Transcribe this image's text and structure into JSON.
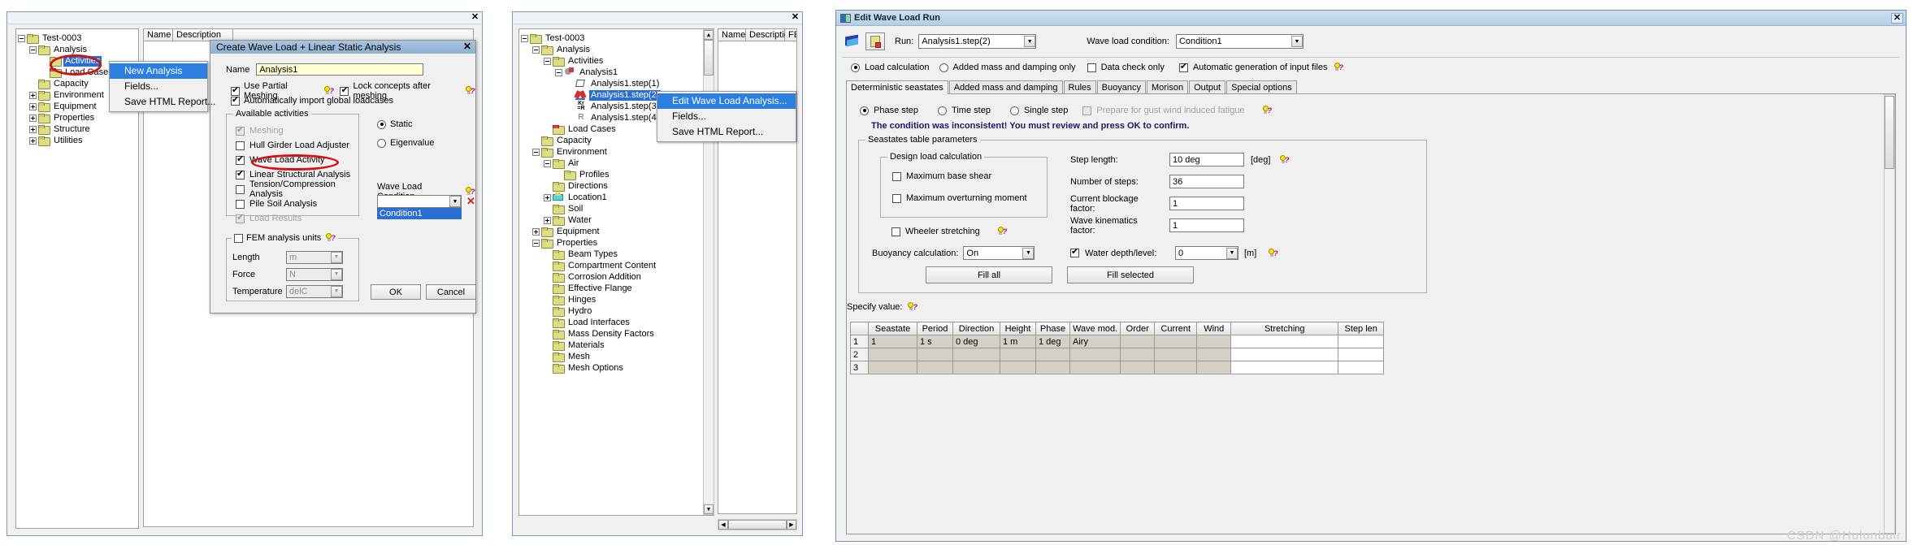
{
  "panel1": {
    "window": {
      "close_label": "✕"
    },
    "tree": {
      "nodes": [
        {
          "label": "Test-0003",
          "depth": 0,
          "toggle": "minus",
          "icon": "folder"
        },
        {
          "label": "Analysis",
          "depth": 1,
          "toggle": "minus",
          "icon": "folder"
        },
        {
          "label": "Activities",
          "depth": 2,
          "toggle": "none",
          "icon": "folder",
          "selected": true
        },
        {
          "label": "Load Cases",
          "depth": 2,
          "toggle": "none",
          "icon": "folder-red"
        },
        {
          "label": "Capacity",
          "depth": 1,
          "toggle": "none",
          "icon": "folder"
        },
        {
          "label": "Environment",
          "depth": 1,
          "toggle": "plus",
          "icon": "folder"
        },
        {
          "label": "Equipment",
          "depth": 1,
          "toggle": "plus",
          "icon": "folder"
        },
        {
          "label": "Properties",
          "depth": 1,
          "toggle": "plus",
          "icon": "folder"
        },
        {
          "label": "Structure",
          "depth": 1,
          "toggle": "plus",
          "icon": "folder"
        },
        {
          "label": "Utilities",
          "depth": 1,
          "toggle": "plus",
          "icon": "folder"
        }
      ]
    },
    "grid": {
      "col_name": "Name",
      "col_desc": "Description"
    },
    "contextmenu": {
      "items": [
        {
          "label": "New Analysis",
          "highlighted": true
        },
        {
          "label": "Fields...",
          "highlighted": false
        },
        {
          "label": "Save HTML Report...",
          "highlighted": false
        }
      ]
    },
    "dialog": {
      "title": "Create Wave Load + Linear Static Analysis",
      "close_label": "✕",
      "name_label": "Name",
      "name_value": "Analysis1",
      "use_partial_meshing": "Use Partial Meshing",
      "lock_concepts": "Lock concepts after meshing",
      "auto_import": "Automatically import global loadcases",
      "available_activities_caption": "Available activities",
      "activities": [
        {
          "label": "Meshing",
          "checked": true,
          "disabled": true
        },
        {
          "label": "Hull Girder Load Adjuster",
          "checked": false,
          "disabled": false
        },
        {
          "label": "Wave Load Activity",
          "checked": true,
          "disabled": false
        },
        {
          "label": "Linear Structural Analysis",
          "checked": true,
          "disabled": false
        },
        {
          "label": "Tension/Compression Analysis",
          "checked": false,
          "disabled": false
        },
        {
          "label": "Pile Soil Analysis",
          "checked": false,
          "disabled": false
        },
        {
          "label": "Load Results",
          "checked": true,
          "disabled": true
        }
      ],
      "radio_static": "Static",
      "radio_eigenvalue": "Eigenvalue",
      "wave_load_condition_label": "Wave Load Condition",
      "wave_load_condition_value": "",
      "wave_load_condition_option": "Condition1",
      "fem_units_caption": "FEM analysis units",
      "units": [
        {
          "label": "Length",
          "value": "m"
        },
        {
          "label": "Force",
          "value": "N"
        },
        {
          "label": "Temperature",
          "value": "delC"
        }
      ],
      "ok_label": "OK",
      "cancel_label": "Cancel"
    }
  },
  "panel2": {
    "window": {
      "close_label": "✕"
    },
    "tree": {
      "nodes": [
        {
          "label": "Test-0003",
          "depth": 0,
          "toggle": "minus",
          "icon": "folder"
        },
        {
          "label": "Analysis",
          "depth": 1,
          "toggle": "minus",
          "icon": "folder"
        },
        {
          "label": "Activities",
          "depth": 2,
          "toggle": "minus",
          "icon": "folder"
        },
        {
          "label": "Analysis1",
          "depth": 3,
          "toggle": "minus",
          "icon": "analysis"
        },
        {
          "label": "Analysis1.step(1)",
          "depth": 4,
          "toggle": "none",
          "icon": "step-mesh"
        },
        {
          "label": "Analysis1.step(2)",
          "depth": 4,
          "toggle": "none",
          "icon": "step-wave",
          "selected": true
        },
        {
          "label": "Analysis1.step(3)",
          "depth": 4,
          "toggle": "none",
          "icon": "step-kr"
        },
        {
          "label": "Analysis1.step(4)",
          "depth": 4,
          "toggle": "none",
          "icon": "step-r"
        },
        {
          "label": "Load Cases",
          "depth": 2,
          "toggle": "none",
          "icon": "folder-red"
        },
        {
          "label": "Capacity",
          "depth": 1,
          "toggle": "none",
          "icon": "folder"
        },
        {
          "label": "Environment",
          "depth": 1,
          "toggle": "minus",
          "icon": "folder"
        },
        {
          "label": "Air",
          "depth": 2,
          "toggle": "minus",
          "icon": "folder"
        },
        {
          "label": "Profiles",
          "depth": 3,
          "toggle": "none",
          "icon": "folder"
        },
        {
          "label": "Directions",
          "depth": 2,
          "toggle": "none",
          "icon": "folder"
        },
        {
          "label": "Location1",
          "depth": 2,
          "toggle": "plus",
          "icon": "location"
        },
        {
          "label": "Soil",
          "depth": 2,
          "toggle": "none",
          "icon": "folder"
        },
        {
          "label": "Water",
          "depth": 2,
          "toggle": "plus",
          "icon": "folder"
        },
        {
          "label": "Equipment",
          "depth": 1,
          "toggle": "plus",
          "icon": "folder"
        },
        {
          "label": "Properties",
          "depth": 1,
          "toggle": "minus",
          "icon": "folder"
        },
        {
          "label": "Beam Types",
          "depth": 2,
          "toggle": "none",
          "icon": "folder"
        },
        {
          "label": "Compartment Content",
          "depth": 2,
          "toggle": "none",
          "icon": "folder"
        },
        {
          "label": "Corrosion Addition",
          "depth": 2,
          "toggle": "none",
          "icon": "folder"
        },
        {
          "label": "Effective Flange",
          "depth": 2,
          "toggle": "none",
          "icon": "folder"
        },
        {
          "label": "Hinges",
          "depth": 2,
          "toggle": "none",
          "icon": "folder"
        },
        {
          "label": "Hydro",
          "depth": 2,
          "toggle": "none",
          "icon": "folder"
        },
        {
          "label": "Load Interfaces",
          "depth": 2,
          "toggle": "none",
          "icon": "folder"
        },
        {
          "label": "Mass Density Factors",
          "depth": 2,
          "toggle": "none",
          "icon": "folder"
        },
        {
          "label": "Materials",
          "depth": 2,
          "toggle": "none",
          "icon": "folder"
        },
        {
          "label": "Mesh",
          "depth": 2,
          "toggle": "none",
          "icon": "folder"
        },
        {
          "label": "Mesh Options",
          "depth": 2,
          "toggle": "none",
          "icon": "folder"
        }
      ]
    },
    "grid": {
      "col_name": "Name",
      "col_desc": "Description",
      "col_fem": "FEM"
    },
    "contextmenu": {
      "items": [
        {
          "label": "Edit Wave Load Analysis...",
          "highlighted": true
        },
        {
          "label": "Fields...",
          "highlighted": false
        },
        {
          "label": "Save HTML Report...",
          "highlighted": false
        }
      ]
    }
  },
  "panel3": {
    "title": "Edit Wave Load Run",
    "close_label": "✕",
    "toolbar": {
      "run_label": "Run:",
      "run_value": "Analysis1.step(2)",
      "wave_load_condition_label": "Wave load condition:",
      "wave_load_condition_value": "Condition1"
    },
    "options": {
      "load_calculation": "Load calculation",
      "added_mass_only": "Added mass and damping only",
      "data_check_only": "Data check only",
      "auto_generation": "Automatic generation of input files"
    },
    "tabs": [
      {
        "label": "Deterministic seastates",
        "active": true
      },
      {
        "label": "Added mass and damping",
        "active": false
      },
      {
        "label": "Rules",
        "active": false
      },
      {
        "label": "Buoyancy",
        "active": false
      },
      {
        "label": "Morison",
        "active": false
      },
      {
        "label": "Output",
        "active": false
      },
      {
        "label": "Special options",
        "active": false
      }
    ],
    "step_modes": {
      "phase_step": "Phase step",
      "time_step": "Time step",
      "single_step": "Single step",
      "gust_wind": "Prepare for gust wind induced fatigue"
    },
    "warning": "The condition was inconsistent! You must review and press OK to confirm.",
    "seastates_caption": "Seastates table parameters",
    "design_load_caption": "Design load calculation",
    "design_load": {
      "max_base_shear": "Maximum base shear",
      "max_overturning": "Maximum overturning moment"
    },
    "wheeler_stretching": "Wheeler stretching",
    "buoyancy_label": "Buoyancy calculation:",
    "buoyancy_value": "On",
    "params": [
      {
        "label": "Step length:",
        "value": "10 deg",
        "unit": "[deg]",
        "help": true
      },
      {
        "label": "Number of steps:",
        "value": "36",
        "unit": "",
        "help": false
      },
      {
        "label": "Current blockage factor:",
        "value": "1",
        "unit": "",
        "help": false
      },
      {
        "label": "Wave kinematics factor:",
        "value": "1",
        "unit": "",
        "help": false
      }
    ],
    "water_depth": {
      "label": "Water depth/level:",
      "value": "0",
      "unit": "[m]"
    },
    "fill_all": "Fill all",
    "fill_selected": "Fill selected",
    "specify_value_label": "Specify value:",
    "table": {
      "columns": [
        "",
        "Seastate",
        "Period",
        "Direction",
        "Height",
        "Phase",
        "Wave mod.",
        "Order",
        "Current",
        "Wind",
        "Stretching",
        "Step len"
      ],
      "rows": [
        {
          "num": "1",
          "cells": [
            "1",
            "1 s",
            "0 deg",
            "1 m",
            "1 deg",
            "Airy",
            "",
            "",
            "",
            "",
            ""
          ]
        },
        {
          "num": "2",
          "cells": [
            "",
            "",
            "",
            "",
            "",
            "",
            "",
            "",
            "",
            "",
            ""
          ]
        },
        {
          "num": "3",
          "cells": [
            "",
            "",
            "",
            "",
            "",
            "",
            "",
            "",
            "",
            "",
            ""
          ]
        }
      ]
    }
  },
  "watermark": "CSDN @Hulunbuir"
}
